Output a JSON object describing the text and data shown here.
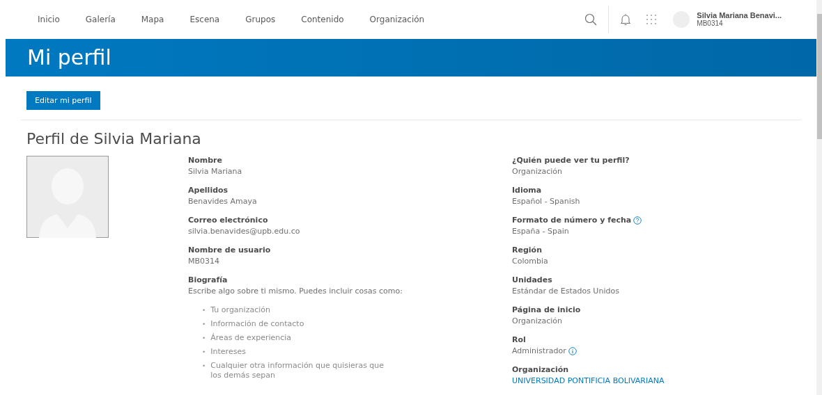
{
  "nav": {
    "items": [
      {
        "label": "Inicio"
      },
      {
        "label": "Galería"
      },
      {
        "label": "Mapa"
      },
      {
        "label": "Escena"
      },
      {
        "label": "Grupos"
      },
      {
        "label": "Contenido"
      },
      {
        "label": "Organización"
      }
    ],
    "user": {
      "name": "Silvia Mariana Benavi...",
      "username": "MB0314"
    }
  },
  "header": {
    "title": "Mi perfil"
  },
  "edit_button": "Editar mi perfil",
  "profile": {
    "title": "Perfil de Silvia Mariana",
    "left_fields": [
      {
        "label": "Nombre",
        "value": "Silvia Mariana"
      },
      {
        "label": "Apellidos",
        "value": "Benavides Amaya"
      },
      {
        "label": "Correo electrónico",
        "value": "silvia.benavides@upb.edu.co"
      },
      {
        "label": "Nombre de usuario",
        "value": "MB0314"
      },
      {
        "label": "Biografía",
        "value": "Escribe algo sobre ti mismo. Puedes incluir cosas como:",
        "bullet_marker": "•",
        "bullets": [
          "Tu organización",
          "Información de contacto",
          "Áreas de experiencia",
          "Intereses",
          "Cualquier otra información que quisieras que los demás sepan"
        ]
      }
    ],
    "right_fields": [
      {
        "label": "¿Quién puede ver tu perfil?",
        "value": "Organización",
        "kind": "text"
      },
      {
        "label": "Idioma",
        "value": "Español - Spanish",
        "kind": "text"
      },
      {
        "label": "Formato de número y fecha",
        "value": "España - Spain",
        "kind": "text",
        "help_icon": true
      },
      {
        "label": "Región",
        "value": "Colombia",
        "kind": "text"
      },
      {
        "label": "Unidades",
        "value": "Estándar de Estados Unidos",
        "kind": "text"
      },
      {
        "label": "Página de inicio",
        "value": "Organización",
        "kind": "text"
      },
      {
        "label": "Rol",
        "value": "Administrador",
        "kind": "text",
        "info_icon": true
      },
      {
        "label": "Organización",
        "value": "UNIVERSIDAD PONTIFICIA BOLIVARIANA",
        "kind": "link"
      }
    ]
  }
}
